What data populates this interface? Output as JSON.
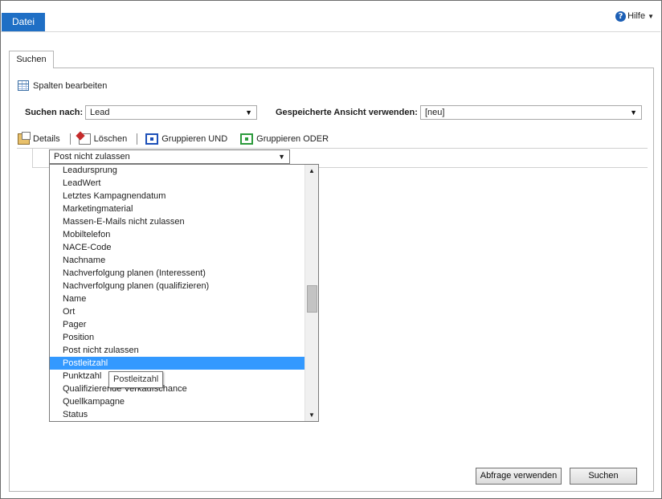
{
  "header": {
    "file_tab": "Datei",
    "help_label": "Hilfe"
  },
  "tab": {
    "label": "Suchen"
  },
  "edit_columns_label": "Spalten bearbeiten",
  "search_for": {
    "label": "Suchen nach:",
    "value": "Lead"
  },
  "saved_view": {
    "label": "Gespeicherte Ansicht verwenden:",
    "value": "[neu]"
  },
  "toolbar": {
    "details": "Details",
    "delete": "Löschen",
    "group_and": "Gruppieren UND",
    "group_or": "Gruppieren ODER"
  },
  "field_select": {
    "value": "Post nicht zulassen"
  },
  "field_options": [
    "Leadursprung",
    "LeadWert",
    "Letztes Kampagnendatum",
    "Marketingmaterial",
    "Massen-E-Mails nicht zulassen",
    "Mobiltelefon",
    "NACE-Code",
    "Nachname",
    "Nachverfolgung planen (Interessent)",
    "Nachverfolgung planen (qualifizieren)",
    "Name",
    "Ort",
    "Pager",
    "Position",
    "Post nicht zulassen",
    "Postleitzahl",
    "Punktzahl",
    "Qualifizierende Verkaufschance",
    "Quellkampagne",
    "Status"
  ],
  "selected_option_index": 15,
  "tooltip": "Postleitzahl",
  "buttons": {
    "use_query": "Abfrage verwenden",
    "search": "Suchen"
  }
}
